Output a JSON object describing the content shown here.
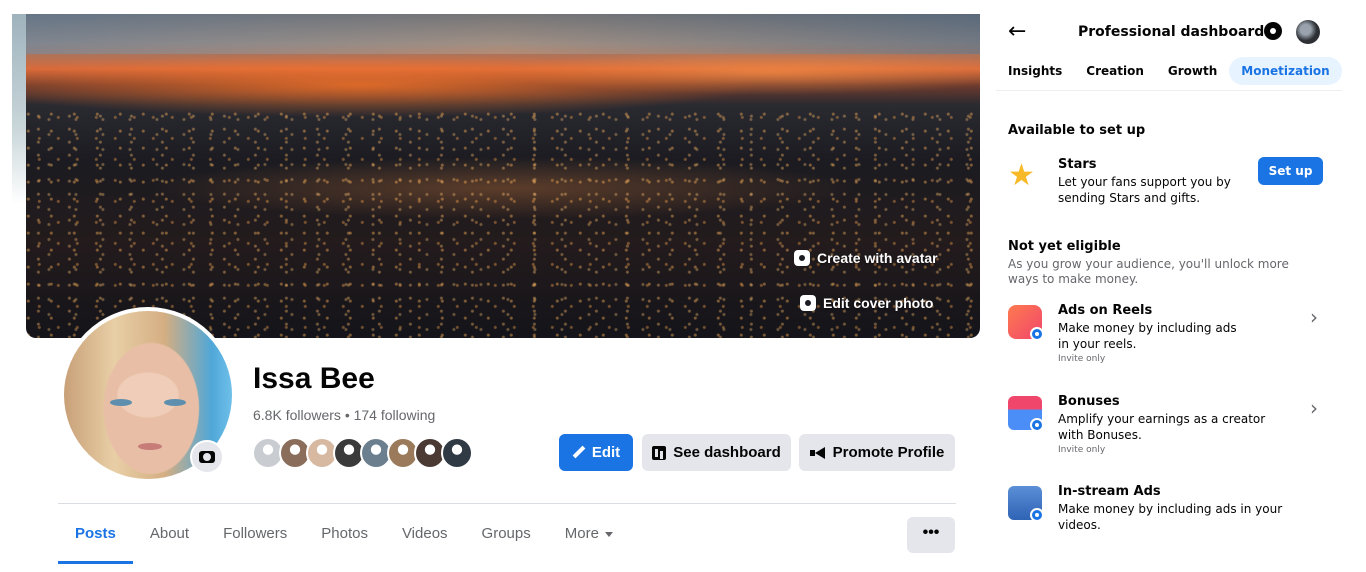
{
  "profile": {
    "cover": {
      "create_avatar_label": "Create with avatar",
      "edit_cover_label": "Edit cover photo"
    },
    "name": "Issa Bee",
    "stats": "6.8K followers • 174 following",
    "friend_colors": [
      "#c9ccd1",
      "#8a6d5b",
      "#d7b8a0",
      "#3b3b3b",
      "#6c7f8f",
      "#9a7a5a",
      "#4a3a33",
      "#2f3a44"
    ],
    "actions": {
      "edit_label": "Edit",
      "dashboard_label": "See dashboard",
      "promote_label": "Promote Profile"
    },
    "tabs": [
      {
        "label": "Posts",
        "active": true
      },
      {
        "label": "About"
      },
      {
        "label": "Followers"
      },
      {
        "label": "Photos"
      },
      {
        "label": "Videos"
      },
      {
        "label": "Groups"
      },
      {
        "label": "More"
      }
    ],
    "more_dots": "•••"
  },
  "dashboard": {
    "back_icon": "←",
    "title": "Professional dashboard",
    "tabs": [
      {
        "label": "Insights"
      },
      {
        "label": "Creation"
      },
      {
        "label": "Growth"
      },
      {
        "label": "Monetization",
        "active": true
      }
    ],
    "available": {
      "title": "Available to set up",
      "stars": {
        "icon": "star-icon",
        "title": "Stars",
        "description": "Let your fans support you by sending Stars and gifts.",
        "button_label": "Set up"
      }
    },
    "not_eligible": {
      "title": "Not yet eligible",
      "subtitle": "As you grow your audience, you'll unlock more ways to make money.",
      "items": [
        {
          "icon": "reels-icon",
          "title": "Ads on Reels",
          "description": "Make money by including ads in your reels.",
          "note": "Invite only"
        },
        {
          "icon": "gift-icon",
          "title": "Bonuses",
          "description": "Amplify your earnings as a creator with Bonuses.",
          "note": "Invite only"
        },
        {
          "icon": "in-stream-icon",
          "title": "In-stream Ads",
          "description": "Make money by including ads in your videos."
        }
      ]
    }
  },
  "colors": {
    "brand_blue": "#1b74e4",
    "secondary_button": "#e4e6eb",
    "secondary_text": "#65676b",
    "active_tab_bg": "#e7f3ff"
  }
}
